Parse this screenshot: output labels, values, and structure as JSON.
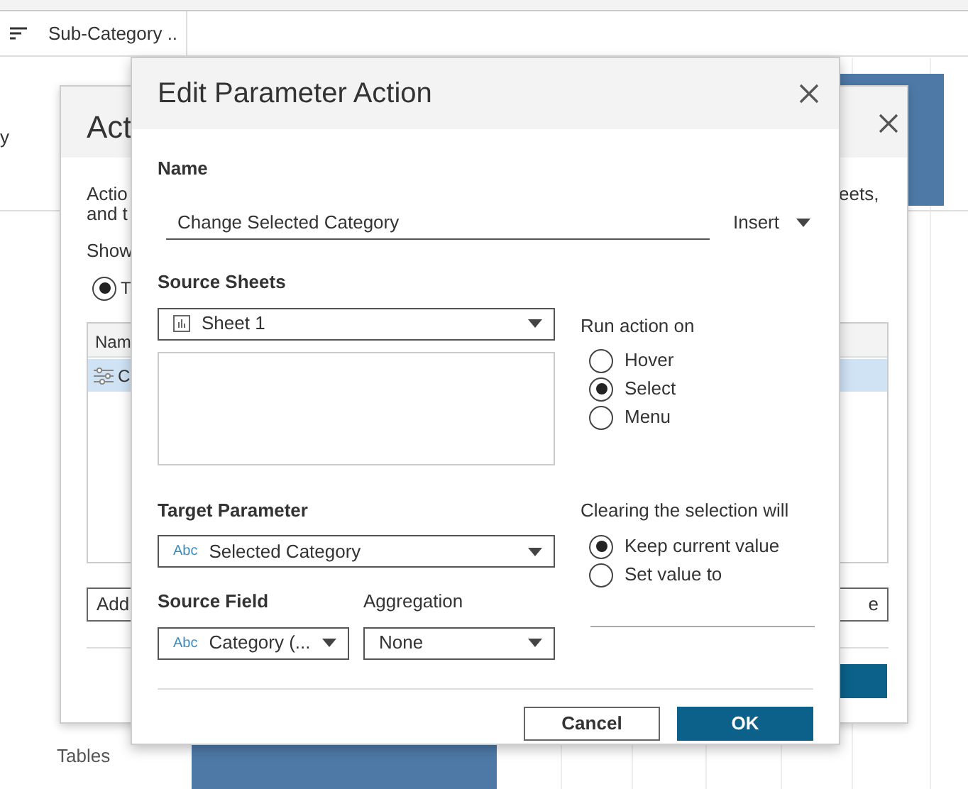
{
  "worksheet": {
    "column_header": "Sub-Category ..",
    "axis_label": "y",
    "row_label": "Tables"
  },
  "actions_dialog": {
    "title": "Act",
    "description_start": [
      "Actio",
      "and t"
    ],
    "description_end": "eets,",
    "show_label": "Show",
    "show_option": {
      "label": "T",
      "selected": true
    },
    "table_header": "Nam",
    "rows": [
      {
        "name": "C",
        "selected": true
      }
    ],
    "add_button": "Add",
    "right_button": "e"
  },
  "dialog": {
    "title": "Edit Parameter Action",
    "name_label": "Name",
    "name_value": "Change Selected Category",
    "insert_button": "Insert",
    "source_sheets_label": "Source Sheets",
    "source_sheet": "Sheet 1",
    "run_action_label": "Run action on",
    "run_action_options": [
      {
        "label": "Hover",
        "selected": false
      },
      {
        "label": "Select",
        "selected": true
      },
      {
        "label": "Menu",
        "selected": false
      }
    ],
    "target_parameter_label": "Target Parameter",
    "target_parameter": {
      "type_tag": "Abc",
      "value": "Selected Category"
    },
    "source_field_label": "Source Field",
    "source_field": {
      "type_tag": "Abc",
      "value": "Category (..."
    },
    "aggregation_label": "Aggregation",
    "aggregation": "None",
    "clearing_label": "Clearing the selection will",
    "clearing_options": [
      {
        "label": "Keep current value",
        "selected": true
      },
      {
        "label": "Set value to",
        "selected": false
      }
    ],
    "buttons": [
      "Cancel",
      "OK"
    ]
  }
}
